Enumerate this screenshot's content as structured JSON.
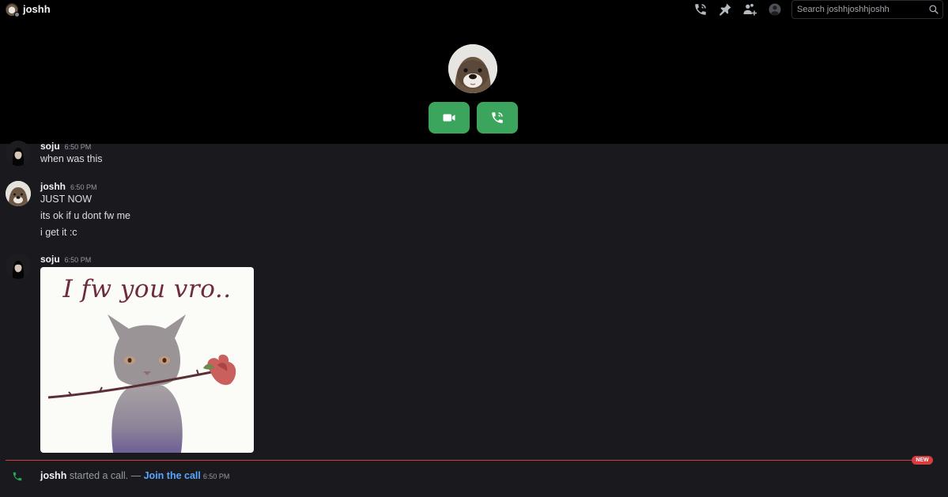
{
  "header": {
    "username": "joshh",
    "search_placeholder": "Search joshhjoshhjoshh",
    "icons": [
      "phone-call-icon",
      "pin-icon",
      "add-friends-icon",
      "profile-icon",
      "search-icon"
    ]
  },
  "call": {
    "buttons": [
      "video-camera-icon",
      "phone-call-icon"
    ],
    "accent": "#3ba55d"
  },
  "messages": [
    {
      "author": "soju",
      "time": "6:50 PM",
      "lines": [
        "when was this"
      ]
    },
    {
      "author": "joshh",
      "time": "6:50 PM",
      "lines": [
        "JUST NOW",
        "its ok if u dont fw me",
        "i get it :c"
      ]
    },
    {
      "author": "soju",
      "time": "6:50 PM",
      "image_caption": "I fw you vro.."
    }
  ],
  "divider": {
    "label": "NEW",
    "color": "#d83c3e"
  },
  "system": {
    "who": "joshh",
    "action": " started a call. — ",
    "join_label": "Join the call",
    "time": "6:50 PM"
  }
}
